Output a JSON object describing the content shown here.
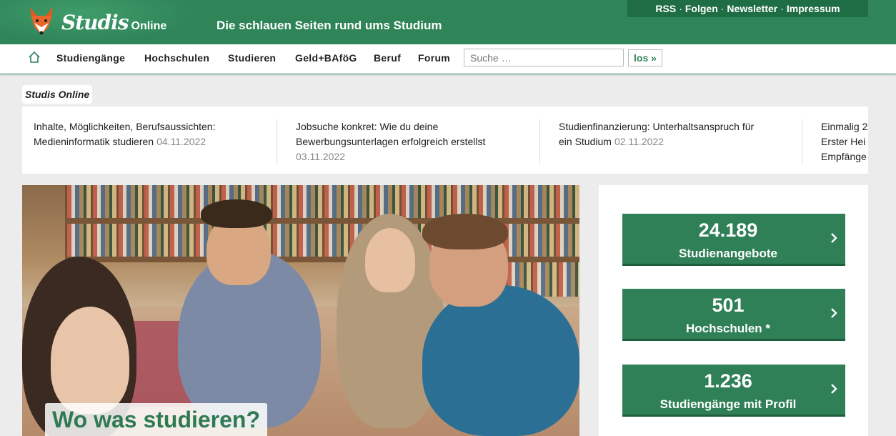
{
  "header": {
    "logo_script": "Studis",
    "logo_online": "Online",
    "tagline": "Die schlauen Seiten rund ums Studium",
    "toplinks": [
      "RSS",
      "Folgen",
      "Newsletter",
      "Impressum"
    ],
    "toplink_separator": "·"
  },
  "nav": {
    "items": [
      "Studiengänge",
      "Hochschulen",
      "Studieren",
      "Geld+BAföG",
      "Beruf",
      "Forum"
    ],
    "search_placeholder": "Suche …",
    "search_button": "los »"
  },
  "section_label": "Studis Online",
  "ticker": [
    {
      "line1": "Inhalte, Möglichkeiten, Berufsaussichten:",
      "line2": "Medieninformatik studieren",
      "date": "04.11.2022"
    },
    {
      "line1": "Jobsuche konkret: Wie du deine",
      "line2": "Bewerbungsunterlagen erfolgreich erstellst",
      "date": "03.11.2022"
    },
    {
      "line1": "Studienfinanzierung: Unterhaltsanspruch für",
      "line2": "ein Studium",
      "date": "02.11.2022"
    },
    {
      "line1": "Einmalig 2",
      "line2": "Erster Hei",
      "line3": "Empfänge"
    }
  ],
  "hero": {
    "caption": "Wo was studieren?"
  },
  "stats": [
    {
      "number": "24.189",
      "label": "Studienangebote"
    },
    {
      "number": "501",
      "label": "Hochschulen *"
    },
    {
      "number": "1.236",
      "label": "Studiengänge mit Profil"
    }
  ],
  "icons": {
    "home": "home-icon",
    "chevron": "chevron-right-icon",
    "logo": "fox-logo-icon"
  },
  "colors": {
    "brand_green": "#2f8458",
    "stat_green": "#2f7f57",
    "toplinks_bg": "#1f6d45"
  }
}
